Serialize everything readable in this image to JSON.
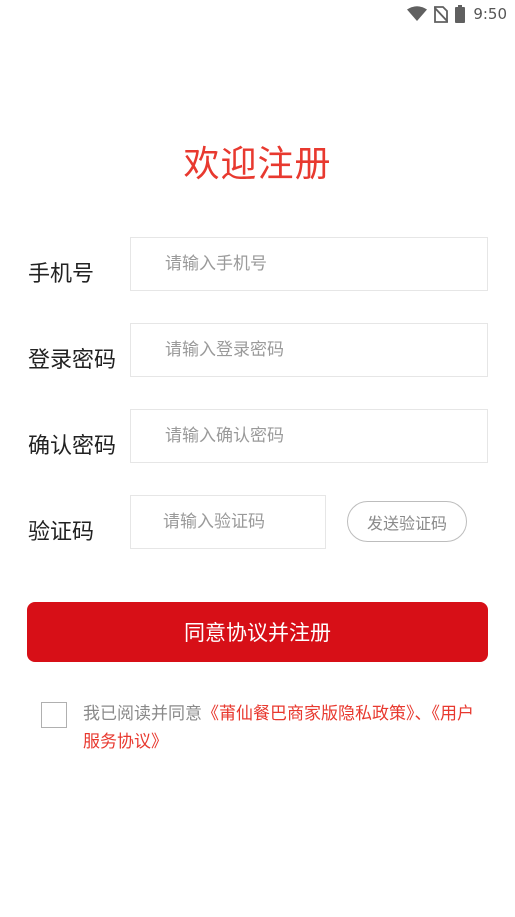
{
  "status_bar": {
    "time": "9:50",
    "icons": [
      "wifi-icon",
      "no-sim-icon",
      "battery-icon"
    ]
  },
  "title": "欢迎注册",
  "form": {
    "phone": {
      "label": "手机号",
      "placeholder": "请输入手机号",
      "value": ""
    },
    "password": {
      "label": "登录密码",
      "placeholder": "请输入登录密码",
      "value": ""
    },
    "confirm_password": {
      "label": "确认密码",
      "placeholder": "请输入确认密码",
      "value": ""
    },
    "code": {
      "label": "验证码",
      "placeholder": "请输入验证码",
      "value": ""
    },
    "send_code_label": "发送验证码"
  },
  "register_button": "同意协议并注册",
  "agreement": {
    "checked": false,
    "prefix": "我已阅读并同意",
    "privacy_link": "《莆仙餐巴商家版隐私政策》",
    "separator": "、",
    "service_link": "《用户服务协议》"
  },
  "colors": {
    "title": "#e8392f",
    "primary_button": "#d70f17",
    "link": "#e8392f"
  }
}
